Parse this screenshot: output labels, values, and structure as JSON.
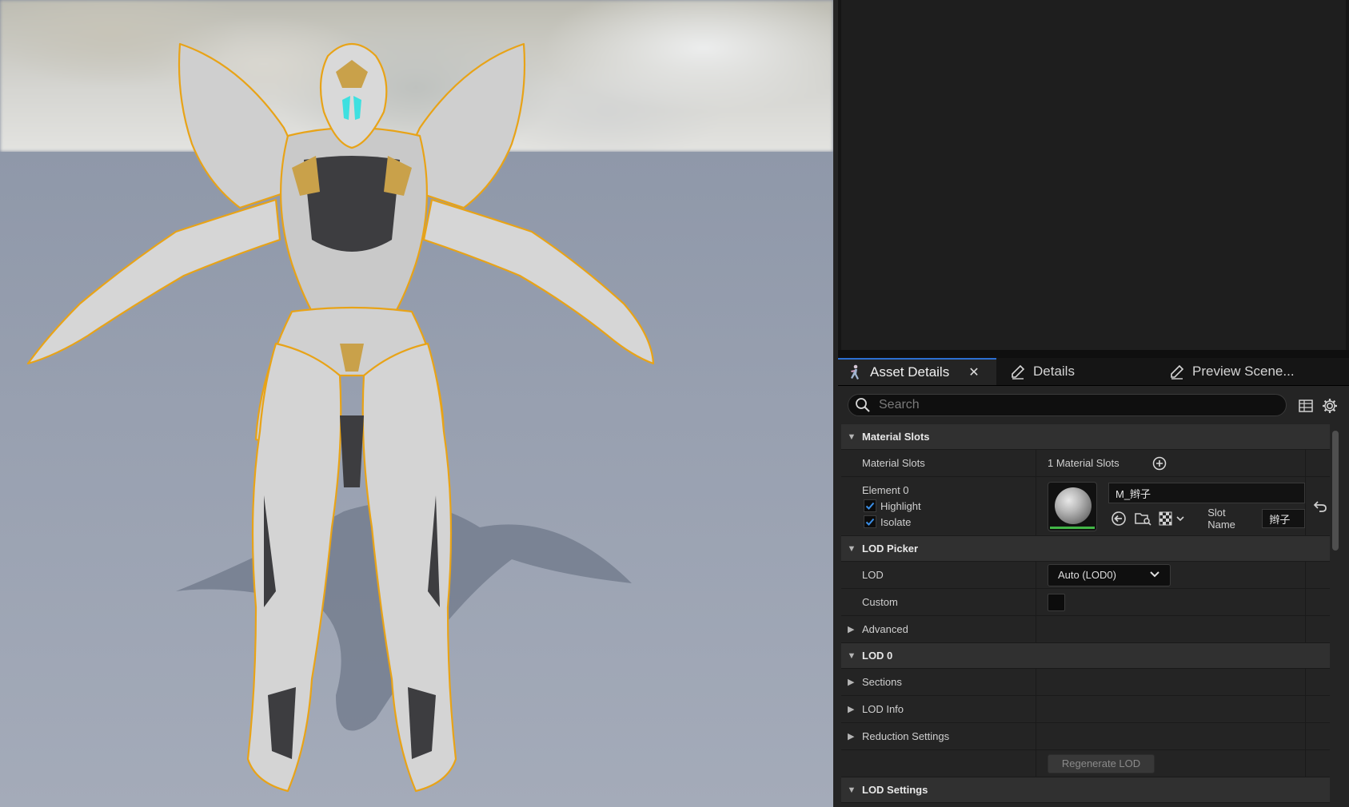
{
  "tabs": [
    {
      "label": "Asset Details",
      "icon": "skeletal-mesh-icon",
      "active": true,
      "closable": true
    },
    {
      "label": "Details",
      "icon": "details-pencil-icon"
    },
    {
      "label": "Preview Scene...",
      "icon": "preview-scene-pencil-icon"
    }
  ],
  "search": {
    "placeholder": "Search"
  },
  "toolbar_icons": [
    "table-view-icon",
    "settings-gear-icon"
  ],
  "sections": {
    "material_slots": {
      "title": "Material Slots",
      "row_label": "Material Slots",
      "count_text": "1 Material Slots",
      "element": {
        "label": "Element 0",
        "highlight_label": "Highlight",
        "highlight_checked": true,
        "isolate_label": "Isolate",
        "isolate_checked": true,
        "material_name": "M_辫子",
        "slot_name_label": "Slot Name",
        "slot_name_value": "辫子"
      }
    },
    "lod_picker": {
      "title": "LOD Picker",
      "lod_label": "LOD",
      "lod_value": "Auto (LOD0)",
      "custom_label": "Custom",
      "custom_checked": false,
      "advanced_label": "Advanced"
    },
    "lod0": {
      "title": "LOD 0",
      "sections_label": "Sections",
      "lod_info_label": "LOD Info",
      "reduction_label": "Reduction Settings",
      "regen_button": "Regenerate LOD"
    },
    "lod_settings": {
      "title": "LOD Settings"
    }
  },
  "colors": {
    "accent_tab": "#2c6fd1",
    "checkbox_tick": "#3a8ee6",
    "selection_outline": "#e8a317",
    "material_valid_bar": "#42b646"
  }
}
